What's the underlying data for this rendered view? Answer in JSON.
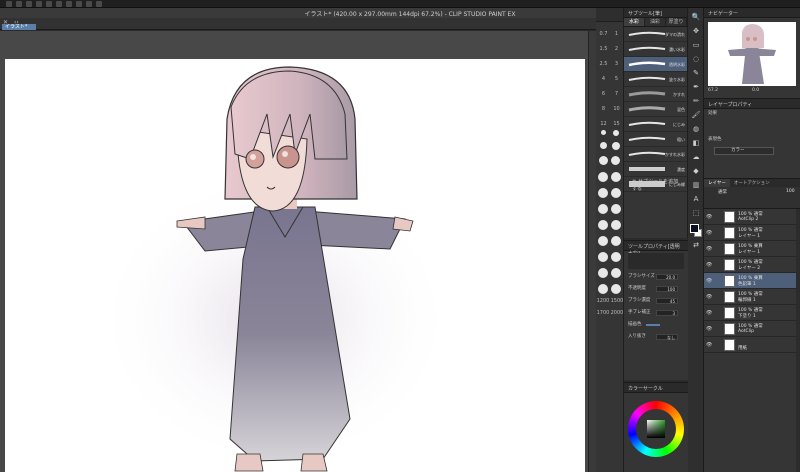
{
  "app": {
    "title": "イラスト* (420.00 x 297.00mm 144dpi 67.2%) - CLIP STUDIO PAINT EX",
    "doc_tab": "イラスト*"
  },
  "brush_size": {
    "values": [
      "0.7",
      "1",
      "1.5",
      "2",
      "2.5",
      "3",
      "4",
      "5",
      "6",
      "7",
      "8",
      "10",
      "12",
      "15"
    ],
    "large_values": [
      "1200",
      "1500",
      "1700",
      "2000"
    ]
  },
  "subtool": {
    "header": "サブツール[筆]",
    "tabs": [
      "水彩",
      "油彩",
      "厚塗り"
    ],
    "brushes": [
      {
        "label": "ダマの潰れ",
        "selected": false
      },
      {
        "label": "濃い水彩",
        "selected": false
      },
      {
        "label": "透明水彩",
        "selected": true
      },
      {
        "label": "塗り水彩",
        "selected": false
      },
      {
        "label": "かすれ",
        "selected": false
      },
      {
        "label": "混色",
        "selected": false
      },
      {
        "label": "にじみ",
        "selected": false
      },
      {
        "label": "粗い",
        "selected": false
      },
      {
        "label": "かすれ水彩",
        "selected": false
      },
      {
        "label": "濃度",
        "selected": false
      },
      {
        "label": "にじみ縁",
        "selected": false
      }
    ],
    "add_label": "サブツールを追加する"
  },
  "tool_property": {
    "header": "ツールプロパティ[透明水彩]",
    "rows": [
      {
        "label": "ブラシサイズ",
        "value": "20.0"
      },
      {
        "label": "不透明度",
        "value": "100"
      },
      {
        "label": "ブラシ濃度",
        "value": "45"
      },
      {
        "label": "手ブレ補正",
        "value": "3"
      },
      {
        "label": "描画色",
        "value": ""
      },
      {
        "label": "入り抜き",
        "value": "なし"
      }
    ]
  },
  "color_wheel": {
    "header": "カラーサークル",
    "current_color": "#2f9e2f"
  },
  "navigator": {
    "header": "ナビゲーター",
    "zoom": "67.2",
    "rotation": "0.0"
  },
  "layer_property": {
    "header": "レイヤープロパティ",
    "effect": "効果",
    "expression_color": "表現色",
    "color_mode": "カラー"
  },
  "layers": {
    "tabs": [
      "レイヤー",
      "オートアクション"
    ],
    "blend_mode": "通常",
    "opacity": "100",
    "items": [
      {
        "line1": "100 % 通常",
        "line2": "AotClip 2",
        "selected": false
      },
      {
        "line1": "100 % 通常",
        "line2": "レイヤー 1",
        "selected": false
      },
      {
        "line1": "100 % 乗算",
        "line2": "レイヤー 1",
        "selected": false
      },
      {
        "line1": "100 % 通常",
        "line2": "レイヤー 2",
        "selected": false
      },
      {
        "line1": "100 % 乗算",
        "line2": "色鉛筆 1",
        "selected": true
      },
      {
        "line1": "100 % 通常",
        "line2": "輪郭線 1",
        "selected": false
      },
      {
        "line1": "100 % 通常",
        "line2": "下塗り 1",
        "selected": false
      },
      {
        "line1": "100 % 通常",
        "line2": "AotClip",
        "selected": false
      },
      {
        "line1": "",
        "line2": "用紙",
        "selected": false
      }
    ]
  },
  "colors": {
    "accent": "#5a7fa8",
    "selection": "#4e5f7a",
    "foreground": "#0d0f24"
  }
}
